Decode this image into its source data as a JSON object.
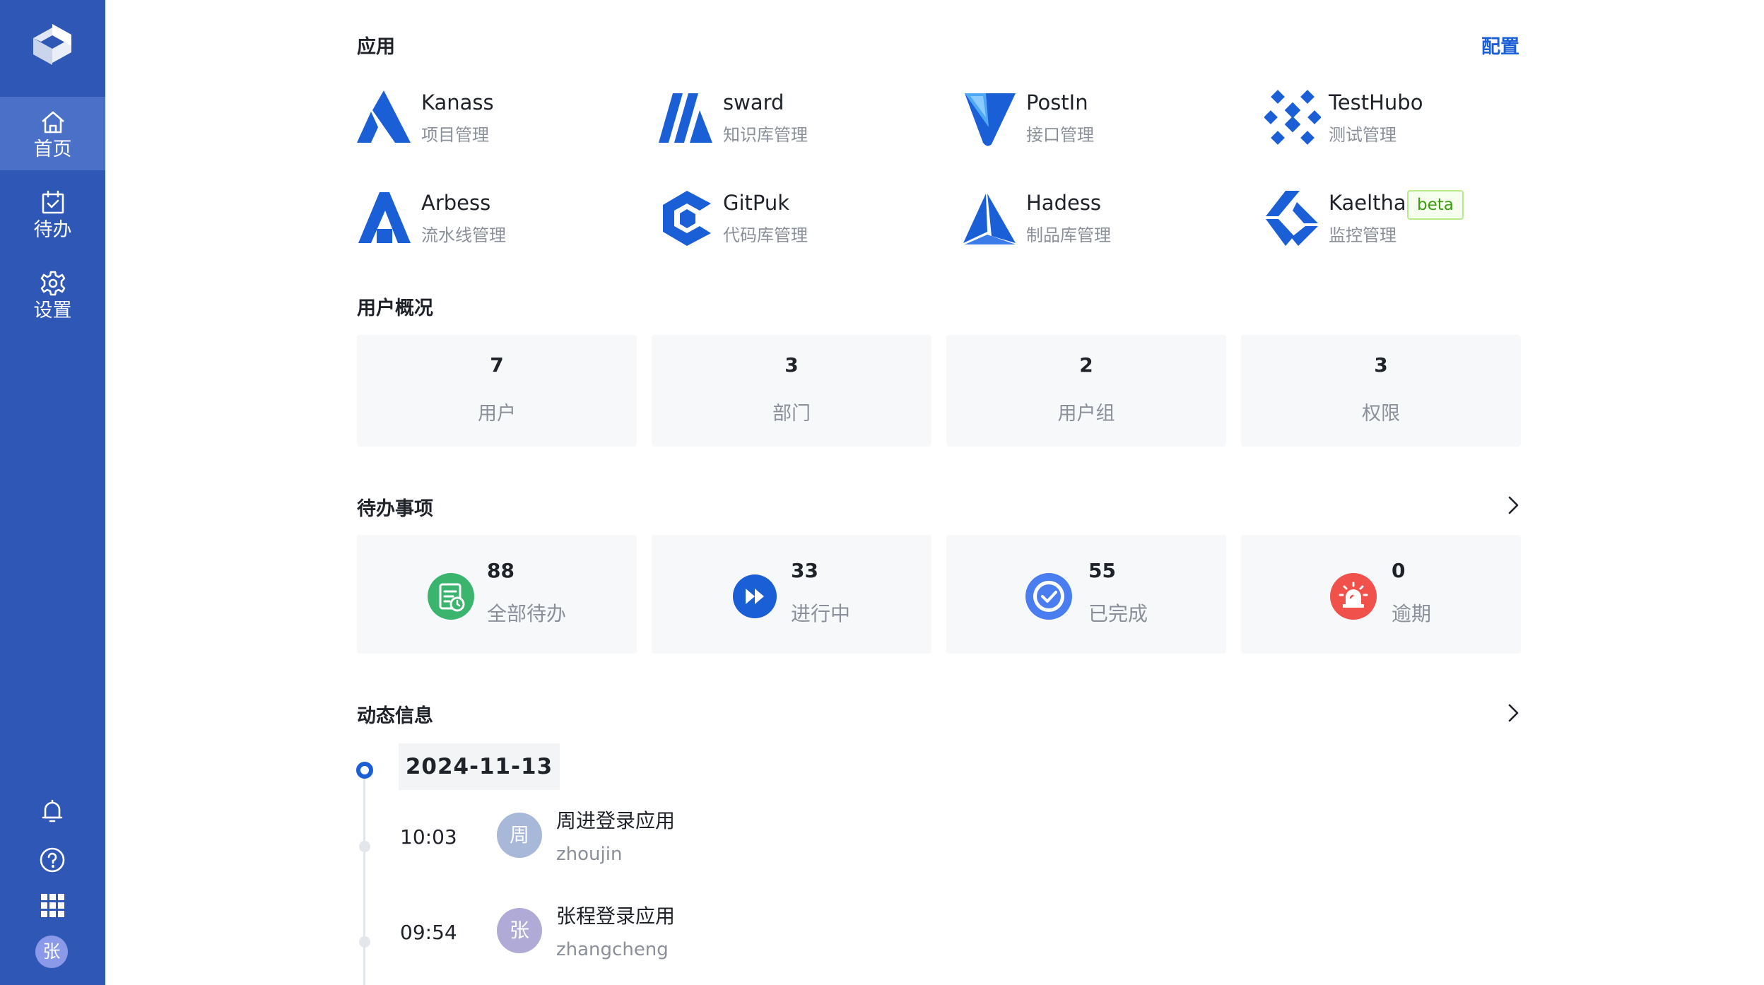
{
  "sidebar": {
    "nav": [
      {
        "label": "首页",
        "icon": "home-icon",
        "active": true
      },
      {
        "label": "待办",
        "icon": "calendar-check-icon",
        "active": false
      },
      {
        "label": "设置",
        "icon": "gear-icon",
        "active": false
      }
    ],
    "bottom_icons": [
      "bell-icon",
      "help-icon",
      "grid-apps-icon"
    ],
    "avatar_text": "张"
  },
  "apps": {
    "title": "应用",
    "config_label": "配置",
    "items": [
      {
        "name": "Kanass",
        "desc": "项目管理"
      },
      {
        "name": "sward",
        "desc": "知识库管理"
      },
      {
        "name": "PostIn",
        "desc": "接口管理"
      },
      {
        "name": "TestHubo",
        "desc": "测试管理"
      },
      {
        "name": "Arbess",
        "desc": "流水线管理"
      },
      {
        "name": "GitPuk",
        "desc": "代码库管理"
      },
      {
        "name": "Hadess",
        "desc": "制品库管理"
      },
      {
        "name": "Kaelthas",
        "desc": "监控管理",
        "badge": "beta"
      }
    ]
  },
  "user_overview": {
    "title": "用户概况",
    "stats": [
      {
        "value": "7",
        "label": "用户"
      },
      {
        "value": "3",
        "label": "部门"
      },
      {
        "value": "2",
        "label": "用户组"
      },
      {
        "value": "3",
        "label": "权限"
      }
    ]
  },
  "todos": {
    "title": "待办事项",
    "items": [
      {
        "value": "88",
        "label": "全部待办",
        "icon": "todo-list-icon",
        "color": "#3bb46e"
      },
      {
        "value": "33",
        "label": "进行中",
        "icon": "fast-forward-icon",
        "color": "#1a5fd6"
      },
      {
        "value": "55",
        "label": "已完成",
        "icon": "check-circle-icon",
        "color": "#4a7ef0"
      },
      {
        "value": "0",
        "label": "逾期",
        "icon": "alarm-icon",
        "color": "#f0514a"
      }
    ]
  },
  "activity": {
    "title": "动态信息",
    "date": "2024-11-13",
    "entries": [
      {
        "time": "10:03",
        "avatar": "周",
        "title": "周进登录应用",
        "user": "zhoujin",
        "avatar_color": "#a8b8d8"
      },
      {
        "time": "09:54",
        "avatar": "张",
        "title": "张程登录应用",
        "user": "zhangcheng",
        "avatar_color": "#b0abd6"
      }
    ]
  }
}
